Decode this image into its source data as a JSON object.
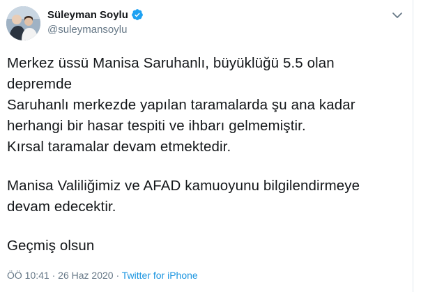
{
  "author": {
    "display_name": "Süleyman Soylu",
    "handle": "@suleymansoylu",
    "verified": true
  },
  "tweet": {
    "lines_p1": [
      "Merkez üssü Manisa Saruhanlı, büyüklüğü 5.5 olan",
      "depremde",
      "Saruhanlı merkezde yapılan taramalarda şu ana kadar",
      "herhangi bir hasar tespiti ve ihbarı gelmemiştir.",
      "Kırsal taramalar devam etmektedir."
    ],
    "lines_p2": [
      "Manisa Valiliğimiz ve AFAD kamuoyunu bilgilendirmeye",
      "devam edecektir."
    ],
    "lines_p3": [
      "Geçmiş olsun"
    ]
  },
  "meta": {
    "time": "ÖÖ 10:41",
    "sep1": " · ",
    "date": "26 Haz 2020",
    "sep2": " · ",
    "source": "Twitter for iPhone"
  },
  "colors": {
    "text": "#14171a",
    "secondary": "#657786",
    "link": "#1b95e0",
    "verified": "#1da1f2"
  },
  "icons": {
    "verified": "verified-badge-icon",
    "caret": "chevron-down-icon"
  }
}
